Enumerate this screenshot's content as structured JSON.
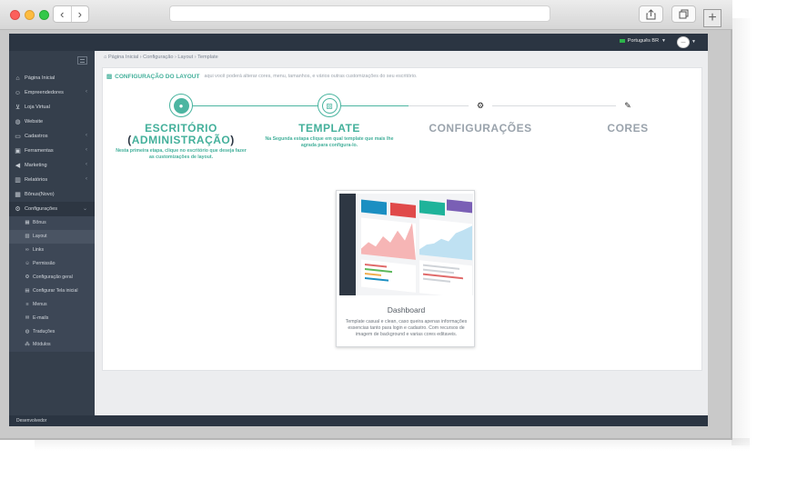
{
  "browser": {
    "nav_back": "‹",
    "nav_forward": "›",
    "new_tab": "+"
  },
  "topbar": {
    "language": "Português BR",
    "avatar": "—"
  },
  "breadcrumb": "Página Inicial › Configuração › Layout › Template",
  "sidebar": {
    "items": [
      {
        "label": "Página Inicial",
        "icon": "home-icon"
      },
      {
        "label": "Empreendedores",
        "icon": "user-icon",
        "expandable": true
      },
      {
        "label": "Loja Virtual",
        "icon": "cart-icon"
      },
      {
        "label": "Website",
        "icon": "globe-icon"
      },
      {
        "label": "Cadastros",
        "icon": "folder-icon",
        "expandable": true
      },
      {
        "label": "Ferramentas",
        "icon": "briefcase-icon",
        "expandable": true
      },
      {
        "label": "Marketing",
        "icon": "megaphone-icon",
        "expandable": true
      },
      {
        "label": "Relatórios",
        "icon": "bar-chart-icon",
        "expandable": true
      },
      {
        "label": "Bônus(Novo)",
        "icon": "calculator-icon"
      },
      {
        "label": "Configurações",
        "icon": "gear-icon",
        "expandable": true
      }
    ],
    "subitems": [
      {
        "label": "Bônus",
        "icon": "table-icon"
      },
      {
        "label": "Layout",
        "icon": "image-icon"
      },
      {
        "label": "Links",
        "icon": "link-icon"
      },
      {
        "label": "Permissão",
        "icon": "user-icon"
      },
      {
        "label": "Configuração geral",
        "icon": "gear-icon"
      },
      {
        "label": "Configurar Tela inicial",
        "icon": "file-icon"
      },
      {
        "label": "Menus",
        "icon": "list-icon"
      },
      {
        "label": "E-mails",
        "icon": "envelope-icon"
      },
      {
        "label": "Traduções",
        "icon": "globe-icon"
      },
      {
        "label": "Módulos",
        "icon": "cubes-icon"
      }
    ]
  },
  "panel": {
    "title": "CONFIGURAÇÃO DO LAYOUT",
    "description": "aqui você poderá alterar cores, menu, tamanhos, e vários outras customizações do seu escritório."
  },
  "steps": [
    {
      "title": "ESCRITÓRIO",
      "title_line2": "ADMINISTRAÇÃO",
      "subtitle": "Nesta primeira etapa, clique no escritório que deseja fazer as customizações de layout.",
      "icon": "user-icon"
    },
    {
      "title": "TEMPLATE",
      "subtitle": "Na Segunda estapa clique em qual template que mais lhe agrada para configura-lo.",
      "icon": "image-icon"
    },
    {
      "title": "CONFIGURAÇÕES",
      "icon": "gear-icon"
    },
    {
      "title": "CORES",
      "icon": "brush-icon"
    }
  ],
  "template_card": {
    "title": "Dashboard",
    "description": "Template casual e clean, caso queira apenas informações essencias tanto para login e cadastro. Com recursos de imagem de background e varias cores editaveis."
  },
  "footer": {
    "text": "Desenvolvedor"
  },
  "colors": {
    "accent": "#4cb5a1",
    "sidebar": "#353f4c",
    "topbar": "#2b3542"
  }
}
